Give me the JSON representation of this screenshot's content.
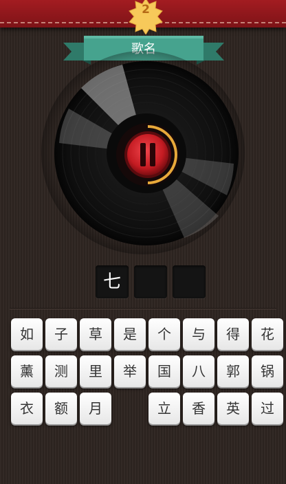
{
  "level": "2",
  "ribbon": {
    "title": "歌名"
  },
  "player": {
    "state": "playing",
    "button_icon": "pause-icon",
    "progress": 0.5
  },
  "answer": {
    "slots": [
      "七",
      "",
      ""
    ]
  },
  "keyboard": {
    "keys": [
      "如",
      "子",
      "草",
      "是",
      "个",
      "与",
      "得",
      "花",
      "薰",
      "测",
      "里",
      "举",
      "国",
      "八",
      "郭",
      "锅",
      "衣",
      "额",
      "月",
      "",
      "立",
      "香",
      "英",
      "过"
    ]
  },
  "colors": {
    "top_bar": "#a31c21",
    "ribbon": "#3f9a86",
    "badge": "#f7c95a",
    "accent_arc": "#e8a93a",
    "button_red": "#d42028"
  }
}
